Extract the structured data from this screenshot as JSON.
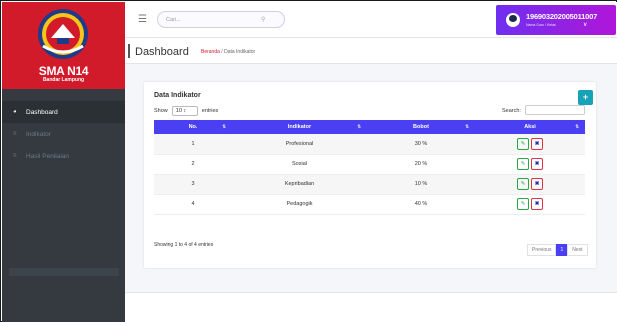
{
  "brand": {
    "name": "SMA N14",
    "subtitle": "Bandar Lampung"
  },
  "sidebar": {
    "items": [
      {
        "label": "Dashboard",
        "icon": "dashboard-icon"
      },
      {
        "label": "Indikator",
        "icon": "list-icon"
      },
      {
        "label": "Hasil Penilaian",
        "icon": "list-icon"
      }
    ]
  },
  "topbar": {
    "search_placeholder": "Cari...",
    "user_id": "196903202005011007",
    "user_role": "Nama Guru / Kelas"
  },
  "header": {
    "title": "Dashboard",
    "breadcrumb_home": "Beranda",
    "breadcrumb_sep": "/",
    "breadcrumb_current": "Data Indikator"
  },
  "card": {
    "title": "Data Indikator",
    "add_label": "+",
    "show_label": "Show",
    "entries_value": "10",
    "entries_label": "entries",
    "search_label": "Search:",
    "columns": [
      "No.",
      "Indikator",
      "Bobot",
      "Aksi"
    ],
    "rows": [
      {
        "no": "1",
        "indikator": "Profesional",
        "bobot": "30 %"
      },
      {
        "no": "2",
        "indikator": "Sosial",
        "bobot": "20 %"
      },
      {
        "no": "3",
        "indikator": "Kepribadian",
        "bobot": "10 %"
      },
      {
        "no": "4",
        "indikator": "Pedagogik",
        "bobot": "40 %"
      }
    ],
    "showing_text": "Showing 1 to 4 of 4 entries",
    "pager": {
      "prev": "Previous",
      "current": "1",
      "next": "Next"
    }
  },
  "colors": {
    "brand_red": "#d11a2a",
    "sidebar_bg": "#343a40",
    "table_header": "#4a3ff2",
    "add_button": "#17a2b8",
    "edit_border": "#28a745",
    "delete_border": "#dc3545"
  }
}
